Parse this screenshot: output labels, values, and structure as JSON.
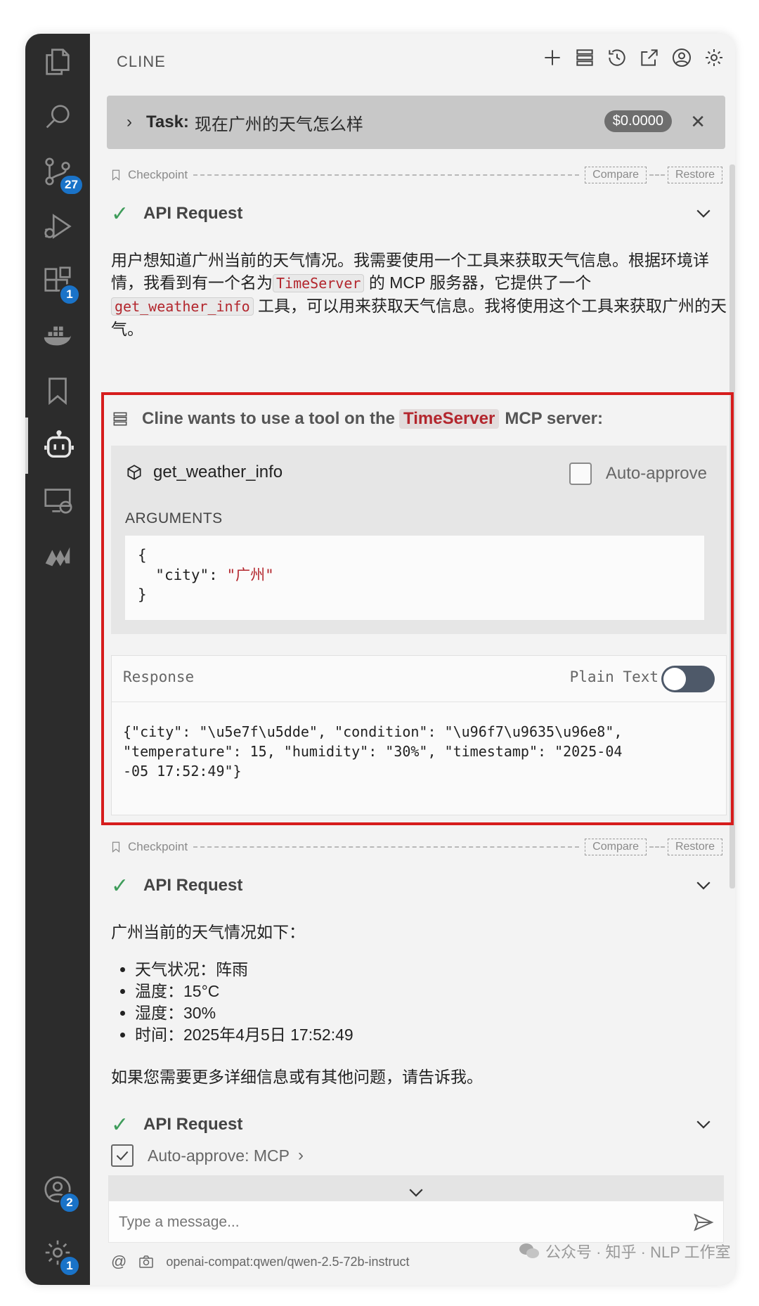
{
  "header": {
    "title": "CLINE"
  },
  "activity_bar": {
    "badges": {
      "source_control": "27",
      "extensions": "1",
      "accounts": "2",
      "manage": "1"
    }
  },
  "task": {
    "label": "Task:",
    "text": "现在广州的天气怎么样",
    "cost": "$0.0000"
  },
  "checkpoint": {
    "label": "Checkpoint",
    "compare": "Compare",
    "restore": "Restore"
  },
  "api_request_label": "API Request",
  "message1": {
    "part1": "用户想知道广州当前的天气情况。我需要使用一个工具来获取天气信息。根据环境详情，我看到有一个名为",
    "chip1": "TimeServer",
    "part2": "的 MCP 服务器，它提供了一个",
    "chip2": "get_weather_info",
    "part3": "工具，可以用来获取天气信息。我将使用这个工具来获取广州的天气。"
  },
  "tool_use": {
    "prefix": "Cline wants to use a tool on the",
    "server": "TimeServer",
    "suffix": "MCP server:",
    "tool_name": "get_weather_info",
    "auto_approve_label": "Auto-approve",
    "arguments_label": "ARGUMENTS",
    "args_open": "{",
    "args_key": "\"city\": ",
    "args_value": "\"广州\"",
    "args_close": "}",
    "response_label": "Response",
    "plain_text_label": "Plain Text",
    "response_body": "{\"city\": \"\\u5e7f\\u5dde\", \"condition\": \"\\u96f7\\u9635\\u96e8\",\n\"temperature\": 15, \"humidity\": \"30%\", \"timestamp\": \"2025-04\n-05 17:52:49\"}"
  },
  "message2": {
    "intro": "广州当前的天气情况如下：",
    "items": [
      "天气状况：阵雨",
      "温度：15°C",
      "湿度：30%",
      "时间：2025年4月5日 17:52:49"
    ],
    "outro": "如果您需要更多详细信息或有其他问题，请告诉我。"
  },
  "auto_approve_mcp": "Auto-approve: MCP",
  "input": {
    "placeholder": "Type a message..."
  },
  "footer": {
    "model": "openai-compat:qwen/qwen-2.5-72b-instruct"
  },
  "watermark": "公众号 · 知乎 · NLP 工作室"
}
